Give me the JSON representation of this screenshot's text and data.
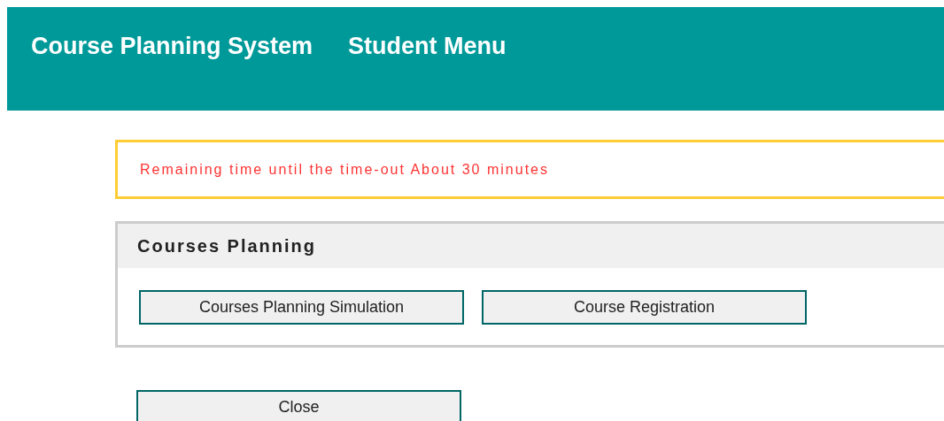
{
  "header": {
    "title": "Course Planning System",
    "subtitle": "Student Menu"
  },
  "notice": "Remaining time until the time-out About 30 minutes",
  "panel": {
    "title": "Courses Planning",
    "buttons": [
      "Courses Planning Simulation",
      "Course Registration"
    ]
  },
  "close_button": "Close"
}
